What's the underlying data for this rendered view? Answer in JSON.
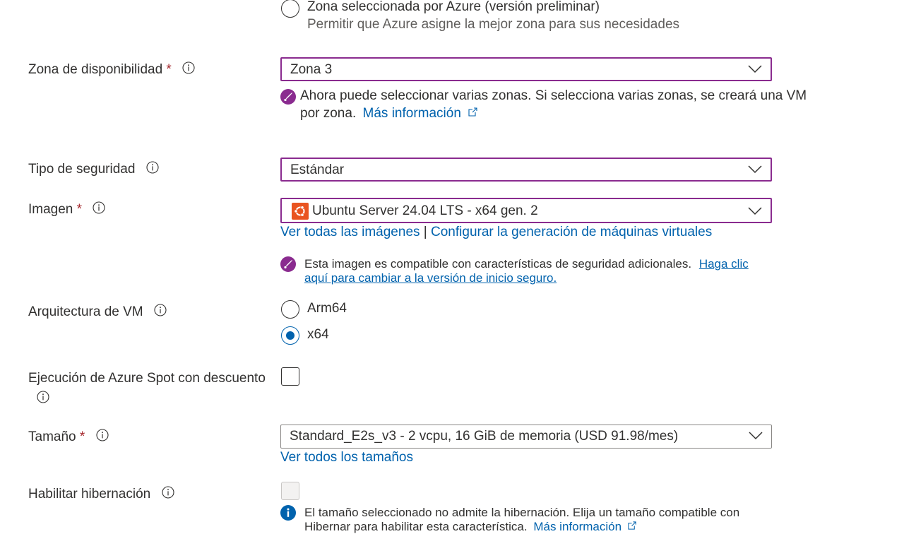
{
  "zone_option": {
    "title": "Zona seleccionada por Azure (versión preliminar)",
    "description": "Permitir que Azure asigne la mejor zona para sus necesidades"
  },
  "availability_zone": {
    "label": "Zona de disponibilidad",
    "required_mark": "*",
    "value": "Zona 3",
    "notice_line1": "Ahora puede seleccionar varias zonas. Si selecciona varias zonas, se creará una VM",
    "notice_line2": "por zona.",
    "notice_link": "Más información"
  },
  "security_type": {
    "label": "Tipo de seguridad",
    "value": "Estándar"
  },
  "image": {
    "label": "Imagen",
    "required_mark": "*",
    "value": "Ubuntu Server 24.04 LTS - x64 gen. 2",
    "link_all_images": "Ver todas las imágenes",
    "separator": "|",
    "link_configure": "Configurar la generación de máquinas virtuales",
    "notice_text": "Esta imagen es compatible con características de seguridad adicionales.",
    "notice_link1": "Haga clic",
    "notice_link2": "aquí para cambiar a la versión de inicio seguro."
  },
  "vm_architecture": {
    "label": "Arquitectura de VM",
    "options": [
      "Arm64",
      "x64"
    ],
    "selected": "x64"
  },
  "spot": {
    "label": "Ejecución de Azure Spot con descuento",
    "checked": false
  },
  "size": {
    "label": "Tamaño",
    "required_mark": "*",
    "value": "Standard_E2s_v3 - 2 vcpu, 16 GiB de memoria (USD 91.98/mes)",
    "link": "Ver todos los tamaños"
  },
  "hibernation": {
    "label": "Habilitar hibernación",
    "checked": false,
    "disabled": true,
    "notice_line1": "El tamaño seleccionado no admite la hibernación. Elija un tamaño compatible con",
    "notice_line2": "Hibernar para habilitar esta característica.",
    "notice_link": "Más información"
  },
  "colors": {
    "accent_border": "#8a2b8f",
    "link": "#0062ad",
    "required": "#a4262c",
    "notice_icon": "#8a2b8f",
    "info_icon_blue": "#0062ad",
    "ubuntu_orange": "#e95420"
  },
  "icons": {
    "info": "info-circle-icon",
    "chevron": "chevron-down-icon",
    "rocket": "rocket-icon",
    "external": "external-link-icon",
    "ubuntu": "ubuntu-logo-icon"
  }
}
